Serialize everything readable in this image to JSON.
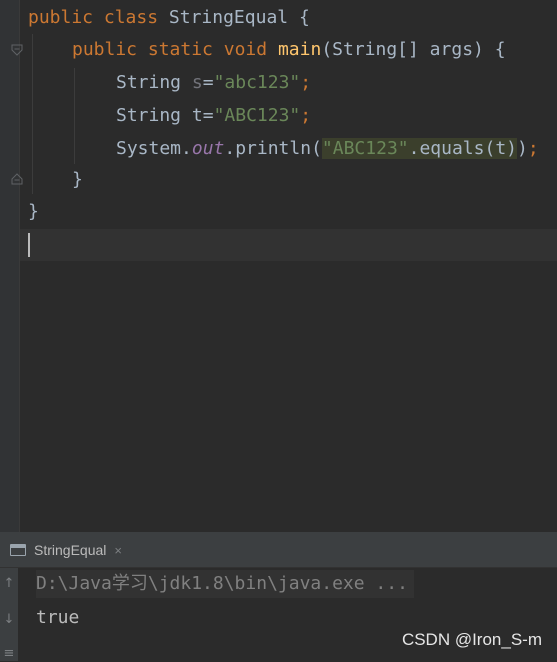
{
  "editor": {
    "code": {
      "line1": {
        "kw1": "public",
        "kw2": "class",
        "name": "StringEqual",
        "brace": "{"
      },
      "line2": {
        "kw1": "public",
        "kw2": "static",
        "kw3": "void",
        "method": "main",
        "params": "(String[] args) {"
      },
      "line3": {
        "type": "String",
        "var": "s",
        "eq": "=",
        "str": "\"abc123\"",
        "semi": ";"
      },
      "line4": {
        "type": "String",
        "var": "t",
        "eq": "=",
        "str": "\"ABC123\"",
        "semi": ";"
      },
      "line5": {
        "obj": "System.",
        "field": "out",
        "call": ".println(",
        "str": "\"ABC123\"",
        "rest": ".equals(t)",
        "close": ")",
        "semi": ";"
      },
      "line6": {
        "brace": "}"
      },
      "line7": {
        "brace": "}"
      }
    }
  },
  "run_panel": {
    "tab_label": "StringEqual",
    "tab_close": "×",
    "console": {
      "command": "D:\\Java学习\\jdk1.8\\bin\\java.exe ...",
      "output": "true"
    },
    "side_tools": [
      "↑",
      "↓",
      "≡"
    ]
  },
  "watermark": "CSDN @Iron_S-m",
  "colors": {
    "background": "#2b2b2b",
    "keyword": "#cc7832",
    "method": "#ffc66d",
    "string": "#6a8759",
    "text": "#a9b7c6",
    "static_field": "#9876aa"
  }
}
